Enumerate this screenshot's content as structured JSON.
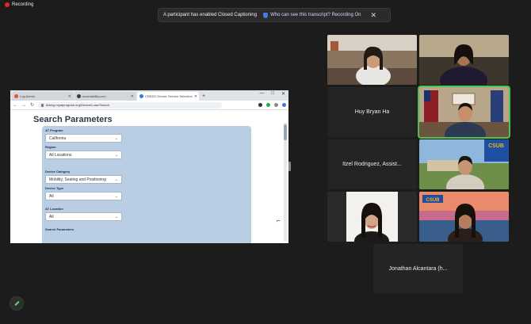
{
  "recording": {
    "label": "Recording"
  },
  "caption_banner": {
    "message": "A participant has enabled Closed Captioning",
    "link": "Who can see this transcript? Recording On",
    "close_glyph": "✕"
  },
  "browser": {
    "tabs": [
      {
        "label": "Log Admin",
        "favicon_color": "#e0572b"
      },
      {
        "label": "accessibility.com",
        "favicon_color": "#3a3a3a"
      },
      {
        "label": "CREDO Device Service Selection",
        "favicon_color": "#3a79d8"
      }
    ],
    "url": "ticking.myatprogram.org/Device/Loan/Search",
    "window_controls": [
      "—",
      "□",
      "✕"
    ]
  },
  "search_page": {
    "title": "Search Parameters",
    "fields": [
      {
        "label": "AT Program",
        "value": "California"
      },
      {
        "label": "Region",
        "value": "All Locations"
      },
      {
        "label": "Device Category",
        "value": "Mobility, Seating and Positioning"
      },
      {
        "label": "Device Type",
        "value": "All"
      },
      {
        "label": "AT Location",
        "value": "All"
      }
    ],
    "section_label": "Search Parameters"
  },
  "participants": [
    {
      "name": "",
      "kind": "video",
      "scene": "woman-room"
    },
    {
      "name": "",
      "kind": "video",
      "scene": "woman-glasses"
    },
    {
      "name": "Huy Bryan Ha",
      "kind": "name"
    },
    {
      "name": "",
      "kind": "video",
      "scene": "man-flags",
      "speaking": true
    },
    {
      "name": "Itzel Rodriguez, Assist...",
      "kind": "name"
    },
    {
      "name": "",
      "kind": "video",
      "scene": "man-campus"
    },
    {
      "name": "",
      "kind": "video",
      "scene": "woman-dark"
    },
    {
      "name": "",
      "kind": "video",
      "scene": "woman-csub"
    },
    {
      "name": "Jonathan Alcantara (h...",
      "kind": "name"
    }
  ],
  "colors": {
    "speaking_border": "#4ec24e",
    "panel": "#b9cde3",
    "csub_blue": "#1f4fa0",
    "csub_gold": "#f3b31b"
  },
  "background_logo": "CSUB"
}
